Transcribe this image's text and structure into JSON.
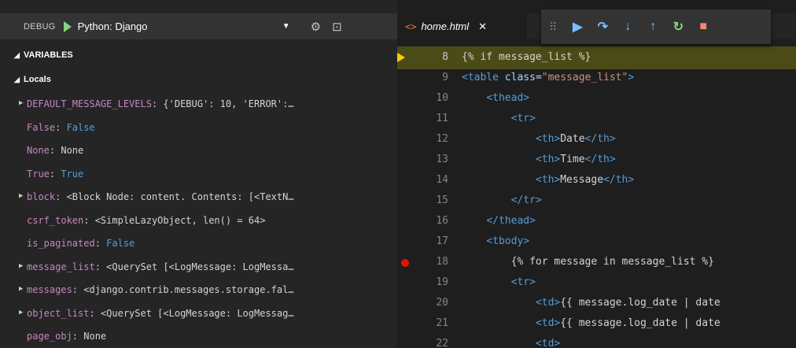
{
  "debug": {
    "label": "DEBUG",
    "config": "Python: Django",
    "icons": [
      "play-icon",
      "gear-icon",
      "console-icon"
    ]
  },
  "variables_section": "VARIABLES",
  "locals_section": "Locals",
  "variables": [
    {
      "name": "DEFAULT_MESSAGE_LEVELS",
      "value": "{'DEBUG': 10, 'ERROR':…",
      "expandable": true,
      "kind": "obj"
    },
    {
      "name": "False",
      "value": "False",
      "expandable": false,
      "kind": "bool"
    },
    {
      "name": "None",
      "value": "None",
      "expandable": false,
      "kind": "obj"
    },
    {
      "name": "True",
      "value": "True",
      "expandable": false,
      "kind": "bool"
    },
    {
      "name": "block",
      "value": "<Block Node: content. Contents: [<TextN…",
      "expandable": true,
      "kind": "obj"
    },
    {
      "name": "csrf_token",
      "value": "<SimpleLazyObject, len() = 64>",
      "expandable": false,
      "kind": "obj"
    },
    {
      "name": "is_paginated",
      "value": "False",
      "expandable": false,
      "kind": "bool"
    },
    {
      "name": "message_list",
      "value": "<QuerySet [<LogMessage: LogMessa…",
      "expandable": true,
      "kind": "obj"
    },
    {
      "name": "messages",
      "value": "<django.contrib.messages.storage.fal…",
      "expandable": true,
      "kind": "obj"
    },
    {
      "name": "object_list",
      "value": "<QuerySet [<LogMessage: LogMessag…",
      "expandable": true,
      "kind": "obj"
    },
    {
      "name": "page_obj",
      "value": "None",
      "expandable": false,
      "kind": "obj"
    }
  ],
  "editor": {
    "tab_title": "home.html",
    "tab_icon": "html-icon",
    "close_icon": "close-icon"
  },
  "debug_toolbar": {
    "buttons": [
      "continue-icon",
      "step-over-icon",
      "step-into-icon",
      "step-out-icon",
      "restart-icon",
      "stop-icon"
    ]
  },
  "code_lines": [
    {
      "n": "8",
      "text": "{% if message_list %}",
      "current": true,
      "breakpoint": false
    },
    {
      "n": "9",
      "text": "<table class=\"message_list\">",
      "current": false,
      "breakpoint": false
    },
    {
      "n": "10",
      "text": "    <thead>",
      "current": false,
      "breakpoint": false
    },
    {
      "n": "11",
      "text": "        <tr>",
      "current": false,
      "breakpoint": false
    },
    {
      "n": "12",
      "text": "            <th>Date</th>",
      "current": false,
      "breakpoint": false
    },
    {
      "n": "13",
      "text": "            <th>Time</th>",
      "current": false,
      "breakpoint": false
    },
    {
      "n": "14",
      "text": "            <th>Message</th>",
      "current": false,
      "breakpoint": false
    },
    {
      "n": "15",
      "text": "        </tr>",
      "current": false,
      "breakpoint": false
    },
    {
      "n": "16",
      "text": "    </thead>",
      "current": false,
      "breakpoint": false
    },
    {
      "n": "17",
      "text": "    <tbody>",
      "current": false,
      "breakpoint": false
    },
    {
      "n": "18",
      "text": "        {% for message in message_list %}",
      "current": false,
      "breakpoint": true
    },
    {
      "n": "19",
      "text": "        <tr>",
      "current": false,
      "breakpoint": false
    },
    {
      "n": "20",
      "text": "            <td>{{ message.log_date | date",
      "current": false,
      "breakpoint": false
    },
    {
      "n": "21",
      "text": "            <td>{{ message.log_date | date",
      "current": false,
      "breakpoint": false
    },
    {
      "n": "22",
      "text": "            <td>",
      "current": false,
      "breakpoint": false
    }
  ],
  "colors": {
    "current_line": "#4b4b18",
    "breakpoint": "#e51400",
    "variable_name": "#c586c0",
    "bool_value": "#569cd6"
  }
}
